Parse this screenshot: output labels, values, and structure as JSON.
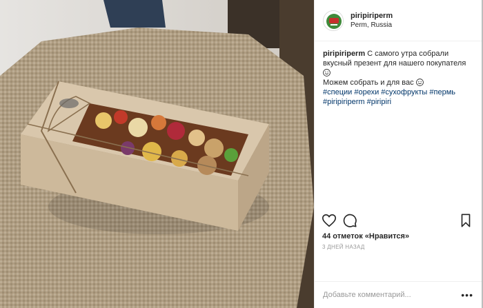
{
  "header": {
    "username": "piripiriperm",
    "location": "Perm, Russia"
  },
  "caption": {
    "username": "piripiriperm",
    "line1": " С самого утра собрали вкусный презент для нашего покупателя ",
    "line2": "Можем собрать и для вас ",
    "hashtags": [
      "#специи",
      "#орехи",
      "#сухофрукты",
      "#пермь",
      "#piripiriperm",
      "#piripiri"
    ]
  },
  "actions": {
    "like_icon": "heart-icon",
    "comment_icon": "comment-icon",
    "save_icon": "bookmark-icon"
  },
  "likes": "44 отметок «Нравится»",
  "time_ago": "3 ДНЕЙ НАЗАД",
  "comment": {
    "placeholder": "Добавьте комментарий..."
  },
  "colors": {
    "hashtag": "#003569",
    "text": "#262626",
    "muted": "#999999"
  }
}
